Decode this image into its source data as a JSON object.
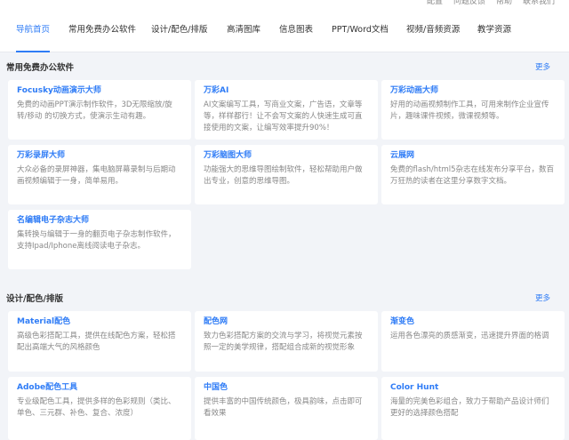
{
  "top_links": [
    "配置",
    "问题反馈",
    "帮助",
    "联系我们"
  ],
  "tabs": [
    "导航首页",
    "常用免费办公软件",
    "设计/配色/排版",
    "高清图库",
    "信息图表",
    "PPT/Word文档",
    "视频/音频资源",
    "教学资源"
  ],
  "section1": {
    "title": "常用免费办公软件",
    "more": "更多",
    "cards": [
      {
        "title": "Focusky动画演示大师",
        "desc": "免费的动画PPT演示制作软件，3D无限缩放/旋转/移动 的切换方式，使演示生动有趣。"
      },
      {
        "title": "万彩AI",
        "desc": "AI文案编写工具，写商业文案，广告语，文章等等，样样都行！让不会写文案的人快速生成可直接使用的文案，让编写效率提升90%！"
      },
      {
        "title": "万彩动画大师",
        "desc": "好用的动画视频制作工具，可用来制作企业宣传片，趣味课件视频，微课视频等。"
      },
      {
        "title": "万彩录屏大师",
        "desc": "大众必备的录屏神器，集电脑屏幕录制与后期动画视频编辑于一身，简单易用。"
      },
      {
        "title": "万彩脑图大师",
        "desc": "功能强大的思维导图绘制软件，轻松帮助用户做出专业，创意的思维导图。"
      },
      {
        "title": "云展网",
        "desc": "免费的flash/html5杂志在线发布分享平台，数百万狂热的读者在这里分享数字文档。"
      },
      {
        "title": "名编辑电子杂志大师",
        "desc": "集转换与编辑于一身的翻页电子杂志制作软件，支持Ipad/Iphone离线阅读电子杂志。"
      }
    ]
  },
  "section2": {
    "title": "设计/配色/排版",
    "more": "更多",
    "cards": [
      {
        "title": "Material配色",
        "desc": "高级色彩搭配工具，提供在线配色方案，轻松搭配出高端大气的风格颜色"
      },
      {
        "title": "配色网",
        "desc": "致力色彩搭配方案的交流与学习，将视觉元素按照一定的美学规律，搭配组合成新的视觉形象"
      },
      {
        "title": "渐变色",
        "desc": "运用各色漂亮的质感渐变，迅速提升界面的格调"
      },
      {
        "title": "Adobe配色工具",
        "desc": "专业级配色工具，提供多样的色彩规则（类比、单色、三元群、补色、复合、浓度）"
      },
      {
        "title": "中国色",
        "desc": "提供丰富的中国传统颜色，极具韵味，点击即可看效果"
      },
      {
        "title": "Color Hunt",
        "desc": "海量的完美色彩组合，致力于帮助产品设计师们更好的选择颜色搭配"
      }
    ]
  }
}
